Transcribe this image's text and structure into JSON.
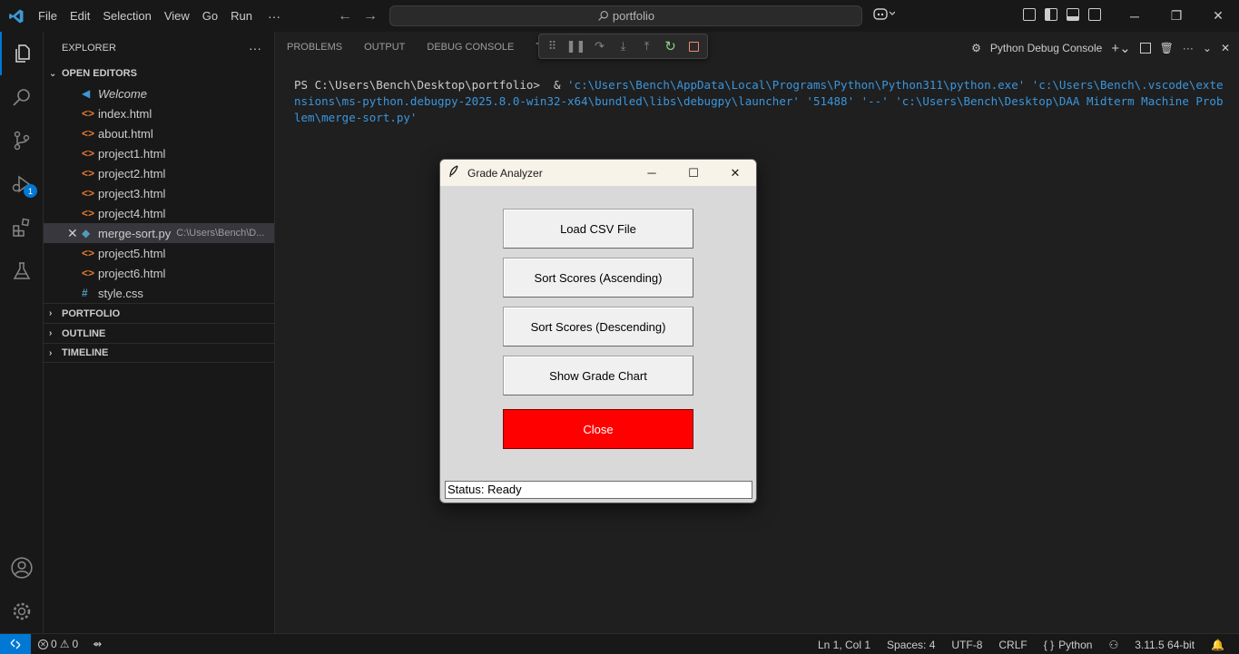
{
  "titlebar": {
    "menu": [
      "File",
      "Edit",
      "Selection",
      "View",
      "Go",
      "Run"
    ],
    "more": "···",
    "search": "portfolio"
  },
  "explorer": {
    "header": "EXPLORER",
    "more": "···",
    "open_editors_label": "OPEN EDITORS",
    "files": [
      {
        "name": "Welcome",
        "icon": "vscode-icon"
      },
      {
        "name": "index.html",
        "icon": "html-icon"
      },
      {
        "name": "about.html",
        "icon": "html-icon"
      },
      {
        "name": "project1.html",
        "icon": "html-icon"
      },
      {
        "name": "project2.html",
        "icon": "html-icon"
      },
      {
        "name": "project3.html",
        "icon": "html-icon"
      },
      {
        "name": "project4.html",
        "icon": "html-icon"
      },
      {
        "name": "merge-sort.py",
        "icon": "python-icon",
        "path": "C:\\Users\\Bench\\D...",
        "active": true
      },
      {
        "name": "project5.html",
        "icon": "html-icon"
      },
      {
        "name": "project6.html",
        "icon": "html-icon"
      },
      {
        "name": "style.css",
        "icon": "css-icon"
      }
    ],
    "sections": [
      "PORTFOLIO",
      "OUTLINE",
      "TIMELINE"
    ]
  },
  "panel": {
    "tabs": [
      "PROBLEMS",
      "OUTPUT",
      "DEBUG CONSOLE",
      "TER"
    ],
    "terminal_name": "Python Debug Console",
    "prompt": "PS C:\\Users\\Bench\\Desktop\\portfolio>  & ",
    "command": "'c:\\Users\\Bench\\AppData\\Local\\Programs\\Python\\Python311\\python.exe' 'c:\\Users\\Bench\\.vscode\\extensions\\ms-python.debugpy-2025.8.0-win32-x64\\bundled\\libs\\debugpy\\launcher' '51488' '--' 'c:\\Users\\Bench\\Desktop\\DAA Midterm Machine Problem\\merge-sort.py'"
  },
  "activity_badge": "1",
  "statusbar": {
    "errors": "0",
    "warnings": "0",
    "position": "Ln 1, Col 1",
    "spaces": "Spaces: 4",
    "encoding": "UTF-8",
    "eol": "CRLF",
    "language": "Python",
    "interpreter": "3.11.5 64-bit"
  },
  "app": {
    "title": "Grade Analyzer",
    "buttons": {
      "load": "Load CSV File",
      "sort_asc": "Sort Scores (Ascending)",
      "sort_desc": "Sort Scores (Descending)",
      "chart": "Show Grade Chart",
      "close": "Close"
    },
    "status": "Status: Ready"
  },
  "colors": {
    "accent": "#0078d4",
    "close_button": "#ff0000",
    "terminal_string": "#3a96dd"
  }
}
